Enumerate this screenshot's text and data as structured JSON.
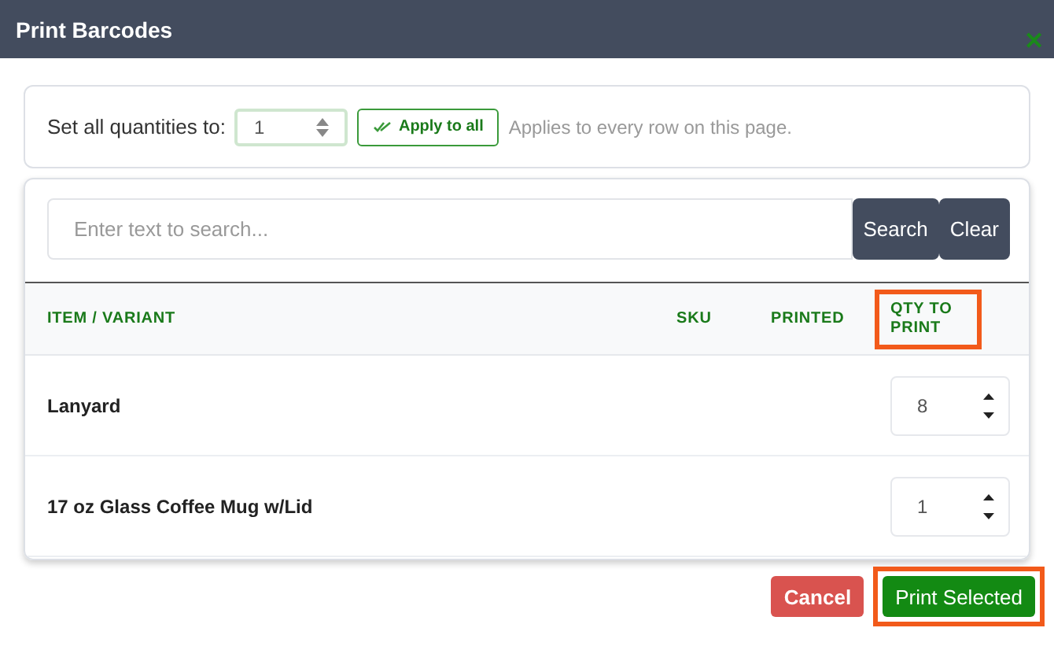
{
  "window": {
    "title": "Print Barcodes",
    "close": "✕"
  },
  "bulk": {
    "label": "Set all quantities to:",
    "value": "1",
    "apply": "Apply to all",
    "hint": "Applies to every row on this page."
  },
  "search": {
    "placeholder": "Enter text to search...",
    "buttons": [
      "Search",
      "Clear"
    ]
  },
  "table": {
    "columns": [
      {
        "label": "ITEM / VARIANT",
        "highlighted": false
      },
      {
        "label": "SKU",
        "highlighted": false
      },
      {
        "label": "PRINTED",
        "highlighted": false
      },
      {
        "label": "QTY TO PRINT",
        "highlighted": true
      }
    ],
    "rows": [
      {
        "item": "Lanyard",
        "qty": "8"
      },
      {
        "item": "17 oz Glass Coffee Mug w/Lid",
        "qty": "1"
      }
    ]
  },
  "buttons": [
    {
      "label": "Cancel",
      "kind": "danger",
      "highlighted": false
    },
    {
      "label": "Print Selected",
      "kind": "primary",
      "highlighted": true
    }
  ]
}
